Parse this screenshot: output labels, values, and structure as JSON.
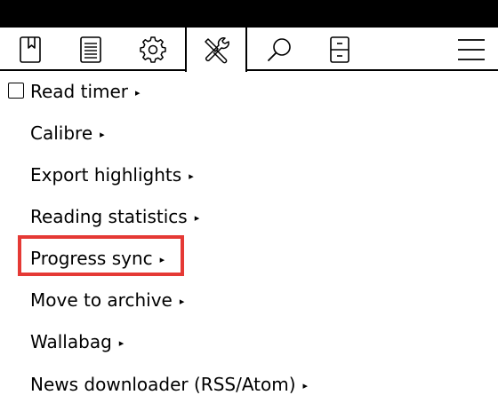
{
  "toolbar": {
    "tabs": [
      {
        "icon": "bookmark-icon"
      },
      {
        "icon": "document-icon"
      },
      {
        "icon": "gear-icon"
      },
      {
        "icon": "tools-icon",
        "active": true
      },
      {
        "icon": "search-icon"
      },
      {
        "icon": "cabinet-icon"
      },
      {
        "icon": "hamburger-menu-icon"
      }
    ]
  },
  "menu": {
    "items": [
      {
        "label": "Read timer",
        "has_checkbox": true,
        "checked": false
      },
      {
        "label": "Calibre"
      },
      {
        "label": "Export highlights"
      },
      {
        "label": "Reading statistics"
      },
      {
        "label": "Progress sync",
        "highlighted": true
      },
      {
        "label": "Move to archive"
      },
      {
        "label": "Wallabag"
      },
      {
        "label": "News downloader (RSS/Atom)"
      }
    ],
    "submenu_arrow": "▸"
  },
  "colors": {
    "highlight_border": "#e53935",
    "status_bar": "#000000"
  }
}
